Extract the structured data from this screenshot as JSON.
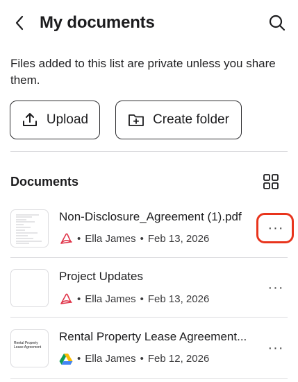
{
  "header": {
    "title": "My documents",
    "back_icon": "chevron-left-icon",
    "search_icon": "search-icon"
  },
  "info_text": "Files added to this list are private unless you share them.",
  "actions": {
    "upload_label": "Upload",
    "create_folder_label": "Create folder"
  },
  "documents": {
    "section_title": "Documents",
    "items": [
      {
        "title": "Non-Disclosure_Agreement (1).pdf",
        "source_icon": "acrobat-icon",
        "owner": "Ella James",
        "date": "Feb 13, 2026",
        "more": "···",
        "highlighted": true
      },
      {
        "title": "Project Updates",
        "source_icon": "acrobat-icon",
        "owner": "Ella James",
        "date": "Feb 13, 2026",
        "more": "···"
      },
      {
        "title": "Rental Property Lease Agreement...",
        "thumb_text": "Rental Property Lease Agreement",
        "source_icon": "google-drive-icon",
        "owner": "Ella James",
        "date": "Feb 12, 2026",
        "more": "···"
      }
    ]
  },
  "colors": {
    "highlight": "#e8341c",
    "acrobat": "#e0354a",
    "divider": "#dcdcdf"
  }
}
